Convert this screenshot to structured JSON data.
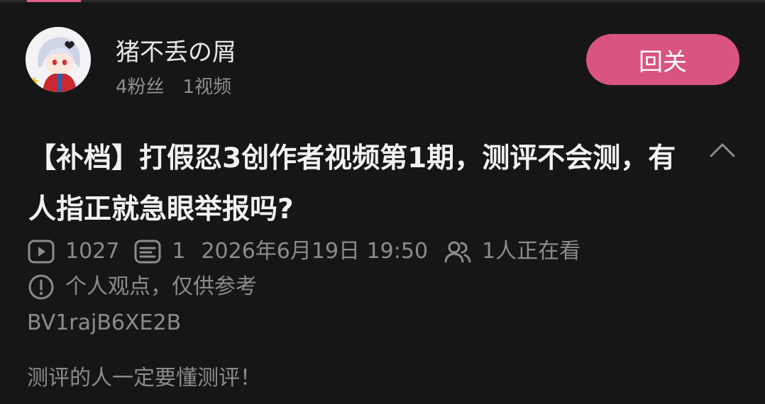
{
  "header": {
    "uploader_name": "猪不丢の屑",
    "followers": "4粉丝",
    "videos": "1视频",
    "follow_button_label": "回关"
  },
  "video": {
    "title": "【补档】打假忍3创作者视频第1期，测评不会测，有人指正就急眼举报吗?",
    "play_count": "1027",
    "danmaku_count": "1",
    "publish_time": "2026年6月19日 19:50",
    "watching_now": "1人正在看",
    "notice": "个人观点，仅供参考",
    "bvid": "BV1rajB6XE2B",
    "description": "测评的人一定要懂测评！"
  },
  "colors": {
    "background": "#161618",
    "accent": "#d9547f",
    "text_primary": "#f1f1f1",
    "text_secondary": "#8c8c8f"
  },
  "icons": {
    "play": "play-count-icon",
    "danmaku": "danmaku-icon",
    "watching": "watching-people-icon",
    "notice": "info-icon",
    "collapse": "chevron-up-icon"
  }
}
